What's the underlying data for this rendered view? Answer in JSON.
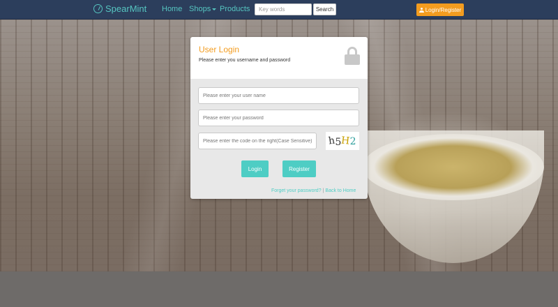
{
  "navbar": {
    "brand": "SpearMint",
    "links": {
      "home": "Home",
      "shops": "Shops",
      "products": "Products"
    },
    "search_placeholder": "Key words",
    "search_button": "Search",
    "login_register": "Login/Register"
  },
  "login": {
    "title": "User Login",
    "subtitle": "Please enter you username and password",
    "username_placeholder": "Please enter your user name",
    "password_placeholder": "Please enter your password",
    "code_placeholder": "Please enter the code on the right(Case Sensitive)",
    "captcha": [
      "h",
      "5",
      "H",
      "2"
    ],
    "login_button": "Login",
    "register_button": "Register",
    "forgot_link": "Forget your password?",
    "separator": "|",
    "back_link": "Back to Home"
  },
  "colors": {
    "navbar_bg": "#2c3e5c",
    "accent_teal": "#4ecdc4",
    "accent_orange": "#f39c1f"
  },
  "icons": [
    "leaf-logo-icon",
    "user-icon",
    "lock-icon",
    "caret-down-icon"
  ]
}
